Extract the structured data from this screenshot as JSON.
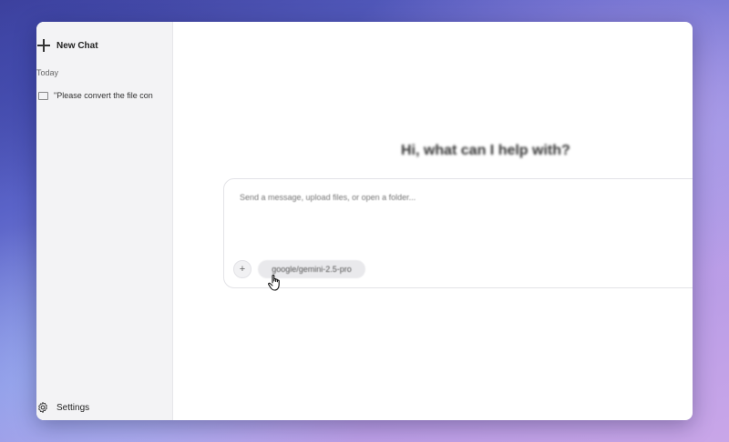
{
  "sidebar": {
    "new_chat_label": "New Chat",
    "section_today": "Today",
    "chat_items": [
      {
        "title": "\"Please convert the file con"
      }
    ],
    "settings_label": "Settings"
  },
  "main": {
    "greeting": "Hi, what can I help with?",
    "composer": {
      "placeholder": "Send a message, upload files, or open a folder...",
      "attach_symbol": "+",
      "model_label": "google/gemini-2.5-pro"
    }
  },
  "colors": {
    "sidebar_bg": "#f3f3f5",
    "window_bg": "#ffffff",
    "pill_bg": "#e9e9ec"
  },
  "icons": [
    "plus-icon",
    "chat-icon",
    "gear-icon",
    "hand-cursor-icon"
  ]
}
